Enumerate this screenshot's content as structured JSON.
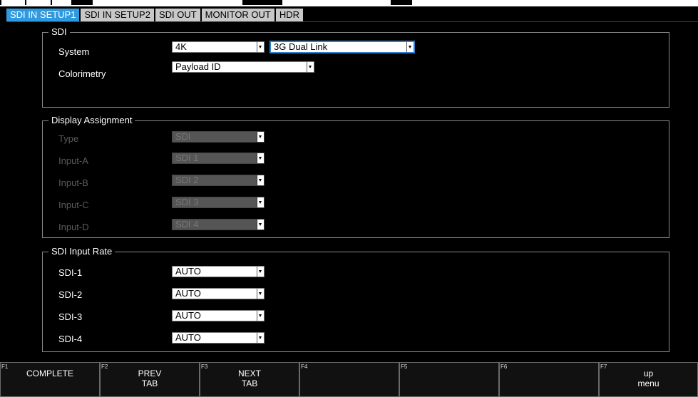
{
  "tabs": [
    {
      "label": "SDI IN SETUP1",
      "active": true
    },
    {
      "label": "SDI IN SETUP2",
      "active": false
    },
    {
      "label": "SDI OUT",
      "active": false
    },
    {
      "label": "MONITOR OUT",
      "active": false
    },
    {
      "label": "HDR",
      "active": false
    }
  ],
  "sdi": {
    "title": "SDI",
    "system_label": "System",
    "system_value": "4K",
    "link_value": "3G Dual Link",
    "colorimetry_label": "Colorimetry",
    "colorimetry_value": "Payload ID"
  },
  "display_assignment": {
    "title": "Display Assignment",
    "rows": [
      {
        "label": "Type",
        "value": "SDI"
      },
      {
        "label": "Input-A",
        "value": "SDI 1"
      },
      {
        "label": "Input-B",
        "value": "SDI 2"
      },
      {
        "label": "Input-C",
        "value": "SDI 3"
      },
      {
        "label": "Input-D",
        "value": "SDI 4"
      }
    ]
  },
  "sdi_input_rate": {
    "title": "SDI Input Rate",
    "rows": [
      {
        "label": "SDI-1",
        "value": "AUTO"
      },
      {
        "label": "SDI-2",
        "value": "AUTO"
      },
      {
        "label": "SDI-3",
        "value": "AUTO"
      },
      {
        "label": "SDI-4",
        "value": "AUTO"
      }
    ]
  },
  "function_keys": [
    {
      "num": "F1",
      "label": "COMPLETE"
    },
    {
      "num": "F2",
      "label": "PREV\nTAB"
    },
    {
      "num": "F3",
      "label": "NEXT\nTAB"
    },
    {
      "num": "F4",
      "label": ""
    },
    {
      "num": "F5",
      "label": ""
    },
    {
      "num": "F6",
      "label": ""
    },
    {
      "num": "F7",
      "label": "up\nmenu"
    }
  ],
  "colors": {
    "accent": "#2f9ae0",
    "tab_inactive": "#c8c8c8",
    "background": "#000000"
  }
}
